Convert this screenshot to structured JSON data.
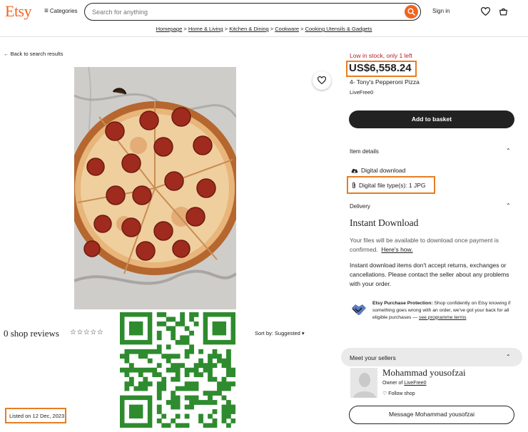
{
  "header": {
    "logo": "Etsy",
    "categories_label": "Categories",
    "search_placeholder": "Search for anything",
    "signin_label": "Sign in"
  },
  "breadcrumb": [
    "Homepage",
    "Home & Living",
    "Kitchen & Dining",
    "Cookware",
    "Cooking Utensils & Gadgets"
  ],
  "breadcrumb_sep": ">",
  "back_label": "Back to search results",
  "product": {
    "stock_text": "Low in stock, only 1 left",
    "price": "US$6,558.24",
    "title": "4- Tony's Pepperoni Pizza",
    "shop": "LiveFree0",
    "add_to_basket": "Add to basket"
  },
  "item_details": {
    "heading": "Item details",
    "digital_download": "Digital download",
    "file_type": "Digital file type(s): 1 JPG"
  },
  "delivery": {
    "heading": "Delivery",
    "instant_title": "Instant Download",
    "available_text": "Your files will be available to download once payment is confirmed.",
    "heres_how": "Here's how.",
    "returns_text": "Instant download items don't accept returns, exchanges or cancellations. Please contact the seller about any problems with your order."
  },
  "protection": {
    "bold": "Etsy Purchase Protection:",
    "text": "Shop confidently on Etsy knowing if something goes wrong with an order, we've got your back for all eligible purchases —",
    "link": "see programme terms"
  },
  "sellers": {
    "heading": "Meet your sellers",
    "name": "Mohammad yousofzai",
    "owner_prefix": "Owner of",
    "owner_shop": "LiveFree0",
    "follow": "Follow shop",
    "message_button": "Message Mohammad yousofzai"
  },
  "reviews": {
    "label": "0 shop reviews",
    "stars": "☆☆☆☆☆",
    "sort_label": "Sort by: Suggested"
  },
  "listed_on": "Listed on 12 Dec, 2023",
  "colors": {
    "brand": "#F1641E",
    "highlight": "#E67E22",
    "stock_red": "#B2232D",
    "qr_green": "#2E8B2E"
  }
}
